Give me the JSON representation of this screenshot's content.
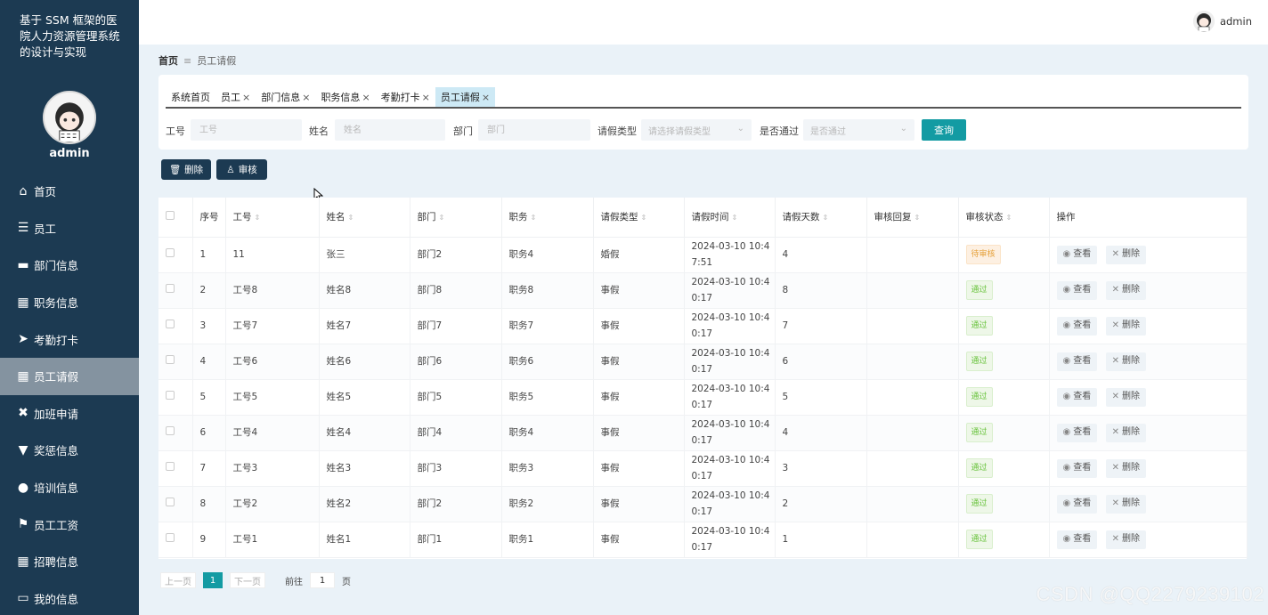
{
  "sidebar": {
    "title": "基于 SSM 框架的医院人力资源管理系统的设计与实现",
    "username": "admin",
    "items": [
      {
        "label": "首页",
        "icon": "home-icon",
        "active": false
      },
      {
        "label": "员工",
        "icon": "sliders-icon",
        "active": false
      },
      {
        "label": "部门信息",
        "icon": "briefcase-icon",
        "active": false
      },
      {
        "label": "职务信息",
        "icon": "grid-icon",
        "active": false
      },
      {
        "label": "考勤打卡",
        "icon": "paper-plane-icon",
        "active": false
      },
      {
        "label": "员工请假",
        "icon": "grid-icon",
        "active": true
      },
      {
        "label": "加班申请",
        "icon": "ticket-icon",
        "active": false
      },
      {
        "label": "奖惩信息",
        "icon": "thumbs-down-icon",
        "active": false
      },
      {
        "label": "培训信息",
        "icon": "bulb-icon",
        "active": false
      },
      {
        "label": "员工工资",
        "icon": "flag-icon",
        "active": false
      },
      {
        "label": "招聘信息",
        "icon": "apps-icon",
        "active": false
      },
      {
        "label": "我的信息",
        "icon": "id-card-icon",
        "active": false
      }
    ]
  },
  "header": {
    "username": "admin"
  },
  "breadcrumb": {
    "home": "首页",
    "current": "员工请假"
  },
  "tabs": [
    {
      "label": "系统首页",
      "closable": false,
      "active": false
    },
    {
      "label": "员工",
      "closable": true,
      "active": false
    },
    {
      "label": "部门信息",
      "closable": true,
      "active": false
    },
    {
      "label": "职务信息",
      "closable": true,
      "active": false
    },
    {
      "label": "考勤打卡",
      "closable": true,
      "active": false
    },
    {
      "label": "员工请假",
      "closable": true,
      "active": true
    }
  ],
  "search": {
    "gonghao_label": "工号",
    "gonghao_placeholder": "工号",
    "xingming_label": "姓名",
    "xingming_placeholder": "姓名",
    "bumen_label": "部门",
    "bumen_placeholder": "部门",
    "qingjia_label": "请假类型",
    "qingjia_placeholder": "请选择请假类型",
    "tongguo_label": "是否通过",
    "tongguo_placeholder": "是否通过",
    "query_label": "查询"
  },
  "actions": {
    "delete_label": "删除",
    "audit_label": "审核"
  },
  "table": {
    "headers": [
      "序号",
      "工号",
      "姓名",
      "部门",
      "职务",
      "请假类型",
      "请假时间",
      "请假天数",
      "审核回复",
      "审核状态",
      "操作"
    ],
    "view_label": "查看",
    "delete_label": "删除",
    "rows": [
      {
        "no": "1",
        "gonghao": "11",
        "name": "张三",
        "dept": "部门2",
        "job": "职务4",
        "type": "婚假",
        "time1": "2024-03-10 10:4",
        "time2": "7:51",
        "days": "4",
        "reply": "",
        "status": "待审核",
        "status_kind": "pending"
      },
      {
        "no": "2",
        "gonghao": "工号8",
        "name": "姓名8",
        "dept": "部门8",
        "job": "职务8",
        "type": "事假",
        "time1": "2024-03-10 10:4",
        "time2": "0:17",
        "days": "8",
        "reply": "",
        "status": "通过",
        "status_kind": "pass"
      },
      {
        "no": "3",
        "gonghao": "工号7",
        "name": "姓名7",
        "dept": "部门7",
        "job": "职务7",
        "type": "事假",
        "time1": "2024-03-10 10:4",
        "time2": "0:17",
        "days": "7",
        "reply": "",
        "status": "通过",
        "status_kind": "pass"
      },
      {
        "no": "4",
        "gonghao": "工号6",
        "name": "姓名6",
        "dept": "部门6",
        "job": "职务6",
        "type": "事假",
        "time1": "2024-03-10 10:4",
        "time2": "0:17",
        "days": "6",
        "reply": "",
        "status": "通过",
        "status_kind": "pass"
      },
      {
        "no": "5",
        "gonghao": "工号5",
        "name": "姓名5",
        "dept": "部门5",
        "job": "职务5",
        "type": "事假",
        "time1": "2024-03-10 10:4",
        "time2": "0:17",
        "days": "5",
        "reply": "",
        "status": "通过",
        "status_kind": "pass"
      },
      {
        "no": "6",
        "gonghao": "工号4",
        "name": "姓名4",
        "dept": "部门4",
        "job": "职务4",
        "type": "事假",
        "time1": "2024-03-10 10:4",
        "time2": "0:17",
        "days": "4",
        "reply": "",
        "status": "通过",
        "status_kind": "pass"
      },
      {
        "no": "7",
        "gonghao": "工号3",
        "name": "姓名3",
        "dept": "部门3",
        "job": "职务3",
        "type": "事假",
        "time1": "2024-03-10 10:4",
        "time2": "0:17",
        "days": "3",
        "reply": "",
        "status": "通过",
        "status_kind": "pass"
      },
      {
        "no": "8",
        "gonghao": "工号2",
        "name": "姓名2",
        "dept": "部门2",
        "job": "职务2",
        "type": "事假",
        "time1": "2024-03-10 10:4",
        "time2": "0:17",
        "days": "2",
        "reply": "",
        "status": "通过",
        "status_kind": "pass"
      },
      {
        "no": "9",
        "gonghao": "工号1",
        "name": "姓名1",
        "dept": "部门1",
        "job": "职务1",
        "type": "事假",
        "time1": "2024-03-10 10:4",
        "time2": "0:17",
        "days": "1",
        "reply": "",
        "status": "通过",
        "status_kind": "pass"
      }
    ]
  },
  "pager": {
    "prev": "上一页",
    "current": "1",
    "next": "下一页",
    "goto": "前往",
    "page_value": "1",
    "page_suffix": "页"
  },
  "watermark": "CSDN @QQ2279239102",
  "colors": {
    "sidebar": "#1c3a52",
    "accent": "#139ba3",
    "active_menu": "#8493a0"
  }
}
